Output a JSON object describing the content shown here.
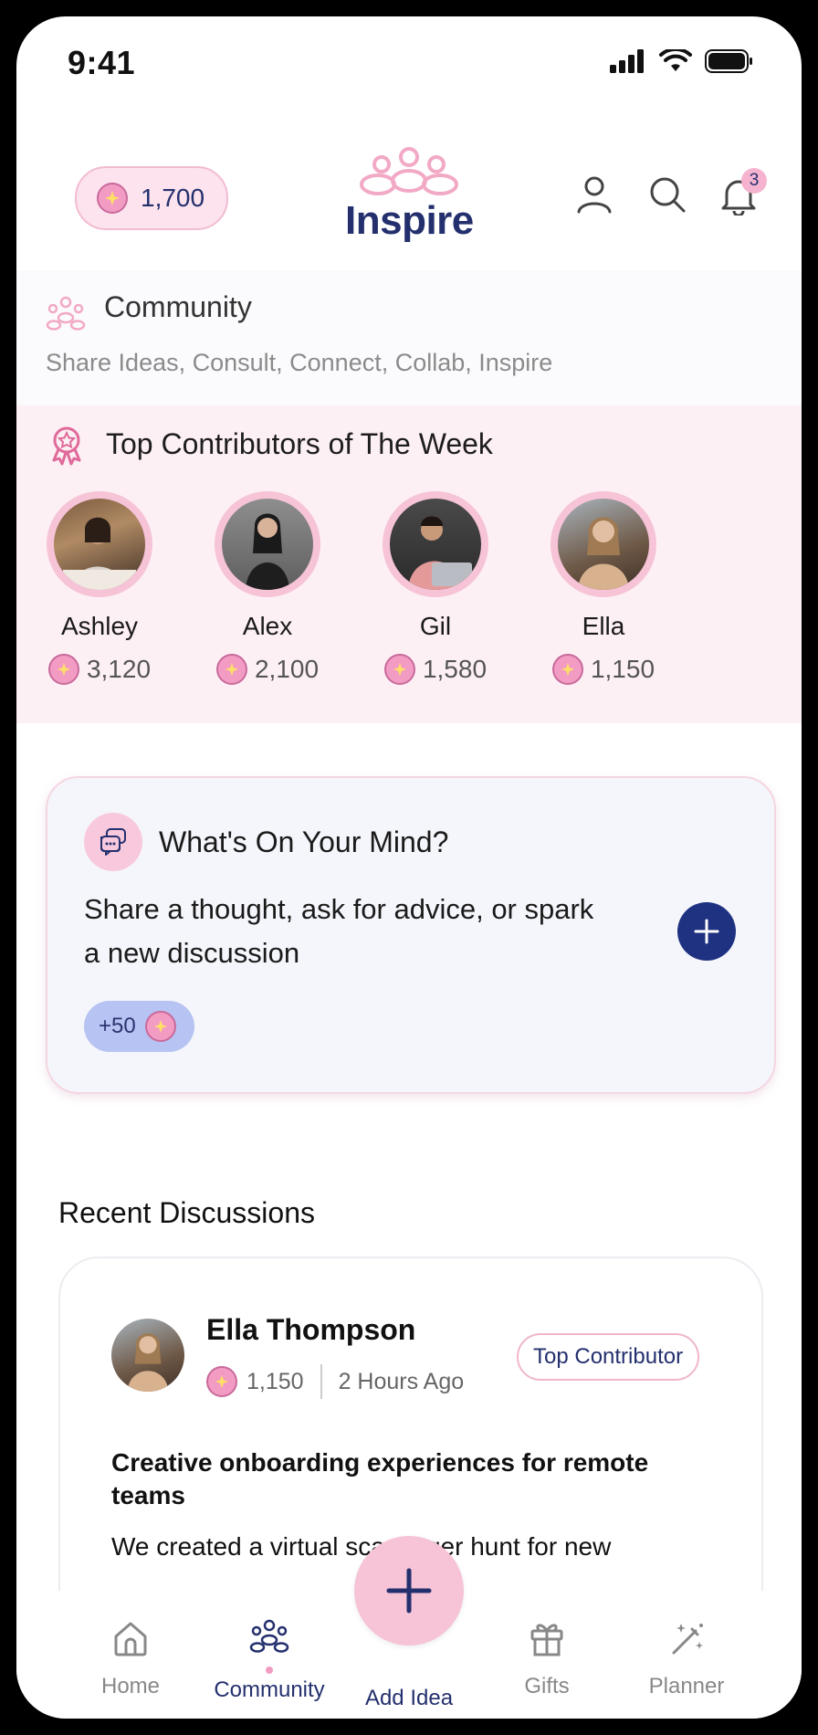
{
  "status_bar": {
    "time": "9:41"
  },
  "header": {
    "points": "1,700",
    "logo_text": "Inspire",
    "notification_count": "3"
  },
  "community": {
    "title": "Community",
    "subtitle": "Share Ideas, Consult, Connect, Collab, Inspire"
  },
  "top_contributors": {
    "title": "Top Contributors of The Week",
    "people": [
      {
        "name": "Ashley",
        "points": "3,120"
      },
      {
        "name": "Alex",
        "points": "2,100"
      },
      {
        "name": "Gil",
        "points": "1,580"
      },
      {
        "name": "Ella",
        "points": "1,150"
      }
    ]
  },
  "mind_card": {
    "title": "What's On Your Mind?",
    "body": "Share a thought, ask for advice, or spark a new discussion",
    "bonus": "+50"
  },
  "recent": {
    "title": "Recent Discussions",
    "post": {
      "author": "Ella Thompson",
      "points": "1,150",
      "time": "2 Hours Ago",
      "tag": "Top Contributor",
      "title": "Creative onboarding experiences for remote teams",
      "body": "We created a virtual scavenger hunt for new"
    }
  },
  "nav": {
    "items": [
      {
        "label": "Home",
        "icon": "home-icon"
      },
      {
        "label": "Community",
        "icon": "community-icon"
      },
      {
        "label": "Add Idea",
        "icon": "plus-icon"
      },
      {
        "label": "Gifts",
        "icon": "gift-icon"
      },
      {
        "label": "Planner",
        "icon": "magic-wand-icon"
      }
    ],
    "active": "Community"
  },
  "colors": {
    "navy": "#24306e",
    "pink": "#f6c3d7",
    "pink_bg": "#fdf0f4",
    "card_bg": "#f5f6fb"
  }
}
